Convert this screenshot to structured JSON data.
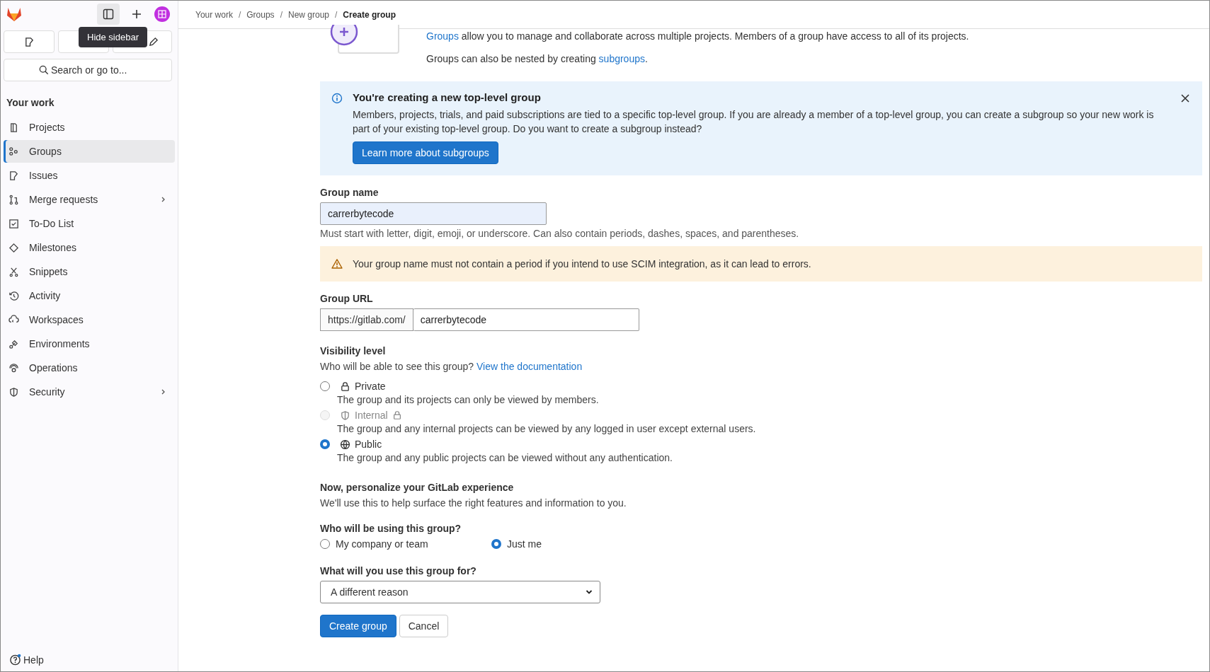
{
  "tooltip": "Hide sidebar",
  "search": {
    "placeholder": "Search or go to..."
  },
  "sidebar": {
    "heading": "Your work",
    "items": [
      {
        "label": "Projects",
        "selected": false,
        "submenu": false
      },
      {
        "label": "Groups",
        "selected": true,
        "submenu": false
      },
      {
        "label": "Issues",
        "selected": false,
        "submenu": false
      },
      {
        "label": "Merge requests",
        "selected": false,
        "submenu": true
      },
      {
        "label": "To-Do List",
        "selected": false,
        "submenu": false
      },
      {
        "label": "Milestones",
        "selected": false,
        "submenu": false
      },
      {
        "label": "Snippets",
        "selected": false,
        "submenu": false
      },
      {
        "label": "Activity",
        "selected": false,
        "submenu": false
      },
      {
        "label": "Workspaces",
        "selected": false,
        "submenu": false
      },
      {
        "label": "Environments",
        "selected": false,
        "submenu": false
      },
      {
        "label": "Operations",
        "selected": false,
        "submenu": false
      },
      {
        "label": "Security",
        "selected": false,
        "submenu": true
      }
    ],
    "help": "Help"
  },
  "breadcrumbs": [
    {
      "label": "Your work",
      "current": false
    },
    {
      "separator": "/",
      "label": "Groups",
      "current": false
    },
    {
      "separator": "/",
      "label": "New group",
      "current": false
    },
    {
      "separator": "/",
      "label": "Create group",
      "current": true
    }
  ],
  "intro": {
    "line1_link": "Groups",
    "line1_rest": "allow you to manage and collaborate across multiple projects. Members of a group have access to all of its projects.",
    "line2": "Groups can also be nested by creating",
    "line2_link": "subgroups",
    "line2_end": "."
  },
  "info_alert": {
    "title": "You're creating a new top-level group",
    "body": "Members, projects, trials, and paid subscriptions are tied to a specific top-level group. If you are already a member of a top-level group, you can create a subgroup so your new work is part of your existing top-level group. Do you want to create a subgroup instead?",
    "button": "Learn more about subgroups"
  },
  "group_name": {
    "label": "Group name",
    "value": "carrerbytecode",
    "help": "Must start with letter, digit, emoji, or underscore. Can also contain periods, dashes, spaces, and parentheses."
  },
  "warning": "Your group name must not contain a period if you intend to use SCIM integration, as it can lead to errors.",
  "group_url": {
    "label": "Group URL",
    "prefix": "https://gitlab.com/",
    "value": "carrerbytecode"
  },
  "visibility": {
    "label": "Visibility level",
    "question": "Who will be able to see this group?",
    "link": "View the documentation",
    "options": [
      {
        "label": "Private",
        "description": "The group and its projects can only be viewed by members.",
        "selected": false,
        "disabled": false,
        "locked": false
      },
      {
        "label": "Internal",
        "description": "The group and any internal projects can be viewed by any logged in user except external users.",
        "selected": false,
        "disabled": true,
        "locked": true
      },
      {
        "label": "Public",
        "description": "The group and any public projects can be viewed without any authentication.",
        "selected": true,
        "disabled": false,
        "locked": false
      }
    ]
  },
  "personalize": {
    "title": "Now, personalize your GitLab experience",
    "subtitle": "We'll use this to help surface the right features and information to you.",
    "who_label": "Who will be using this group?",
    "who_options": [
      {
        "label": "My company or team",
        "selected": false
      },
      {
        "label": "Just me",
        "selected": true
      }
    ],
    "use_label": "What will you use this group for?",
    "use_value": "A different reason"
  },
  "actions": [
    {
      "label": "Create group",
      "kind": "primary"
    },
    {
      "label": "Cancel",
      "kind": "secondary"
    }
  ]
}
